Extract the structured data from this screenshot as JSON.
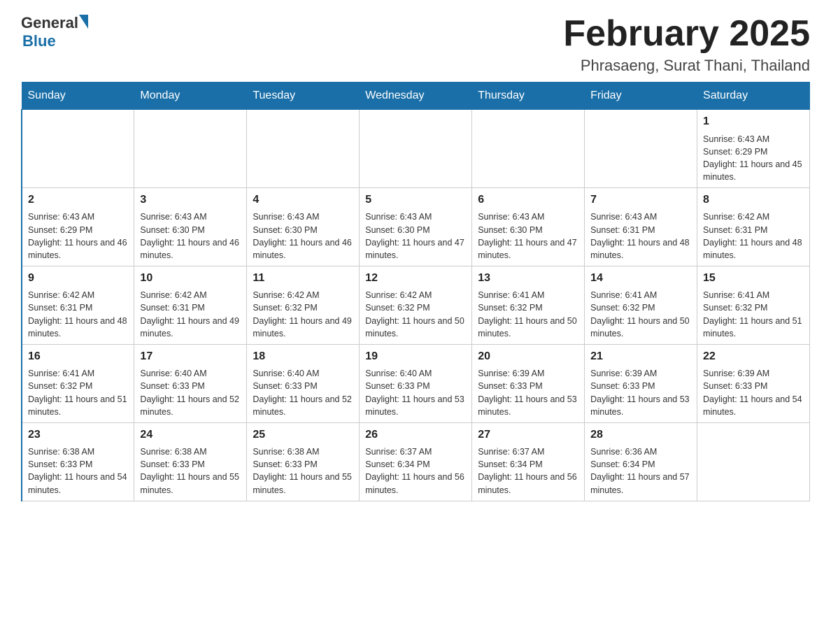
{
  "header": {
    "logo_general": "General",
    "logo_blue": "Blue",
    "month_title": "February 2025",
    "location": "Phrasaeng, Surat Thani, Thailand"
  },
  "weekdays": [
    "Sunday",
    "Monday",
    "Tuesday",
    "Wednesday",
    "Thursday",
    "Friday",
    "Saturday"
  ],
  "weeks": [
    [
      {
        "day": "",
        "sunrise": "",
        "sunset": "",
        "daylight": ""
      },
      {
        "day": "",
        "sunrise": "",
        "sunset": "",
        "daylight": ""
      },
      {
        "day": "",
        "sunrise": "",
        "sunset": "",
        "daylight": ""
      },
      {
        "day": "",
        "sunrise": "",
        "sunset": "",
        "daylight": ""
      },
      {
        "day": "",
        "sunrise": "",
        "sunset": "",
        "daylight": ""
      },
      {
        "day": "",
        "sunrise": "",
        "sunset": "",
        "daylight": ""
      },
      {
        "day": "1",
        "sunrise": "Sunrise: 6:43 AM",
        "sunset": "Sunset: 6:29 PM",
        "daylight": "Daylight: 11 hours and 45 minutes."
      }
    ],
    [
      {
        "day": "2",
        "sunrise": "Sunrise: 6:43 AM",
        "sunset": "Sunset: 6:29 PM",
        "daylight": "Daylight: 11 hours and 46 minutes."
      },
      {
        "day": "3",
        "sunrise": "Sunrise: 6:43 AM",
        "sunset": "Sunset: 6:30 PM",
        "daylight": "Daylight: 11 hours and 46 minutes."
      },
      {
        "day": "4",
        "sunrise": "Sunrise: 6:43 AM",
        "sunset": "Sunset: 6:30 PM",
        "daylight": "Daylight: 11 hours and 46 minutes."
      },
      {
        "day": "5",
        "sunrise": "Sunrise: 6:43 AM",
        "sunset": "Sunset: 6:30 PM",
        "daylight": "Daylight: 11 hours and 47 minutes."
      },
      {
        "day": "6",
        "sunrise": "Sunrise: 6:43 AM",
        "sunset": "Sunset: 6:30 PM",
        "daylight": "Daylight: 11 hours and 47 minutes."
      },
      {
        "day": "7",
        "sunrise": "Sunrise: 6:43 AM",
        "sunset": "Sunset: 6:31 PM",
        "daylight": "Daylight: 11 hours and 48 minutes."
      },
      {
        "day": "8",
        "sunrise": "Sunrise: 6:42 AM",
        "sunset": "Sunset: 6:31 PM",
        "daylight": "Daylight: 11 hours and 48 minutes."
      }
    ],
    [
      {
        "day": "9",
        "sunrise": "Sunrise: 6:42 AM",
        "sunset": "Sunset: 6:31 PM",
        "daylight": "Daylight: 11 hours and 48 minutes."
      },
      {
        "day": "10",
        "sunrise": "Sunrise: 6:42 AM",
        "sunset": "Sunset: 6:31 PM",
        "daylight": "Daylight: 11 hours and 49 minutes."
      },
      {
        "day": "11",
        "sunrise": "Sunrise: 6:42 AM",
        "sunset": "Sunset: 6:32 PM",
        "daylight": "Daylight: 11 hours and 49 minutes."
      },
      {
        "day": "12",
        "sunrise": "Sunrise: 6:42 AM",
        "sunset": "Sunset: 6:32 PM",
        "daylight": "Daylight: 11 hours and 50 minutes."
      },
      {
        "day": "13",
        "sunrise": "Sunrise: 6:41 AM",
        "sunset": "Sunset: 6:32 PM",
        "daylight": "Daylight: 11 hours and 50 minutes."
      },
      {
        "day": "14",
        "sunrise": "Sunrise: 6:41 AM",
        "sunset": "Sunset: 6:32 PM",
        "daylight": "Daylight: 11 hours and 50 minutes."
      },
      {
        "day": "15",
        "sunrise": "Sunrise: 6:41 AM",
        "sunset": "Sunset: 6:32 PM",
        "daylight": "Daylight: 11 hours and 51 minutes."
      }
    ],
    [
      {
        "day": "16",
        "sunrise": "Sunrise: 6:41 AM",
        "sunset": "Sunset: 6:32 PM",
        "daylight": "Daylight: 11 hours and 51 minutes."
      },
      {
        "day": "17",
        "sunrise": "Sunrise: 6:40 AM",
        "sunset": "Sunset: 6:33 PM",
        "daylight": "Daylight: 11 hours and 52 minutes."
      },
      {
        "day": "18",
        "sunrise": "Sunrise: 6:40 AM",
        "sunset": "Sunset: 6:33 PM",
        "daylight": "Daylight: 11 hours and 52 minutes."
      },
      {
        "day": "19",
        "sunrise": "Sunrise: 6:40 AM",
        "sunset": "Sunset: 6:33 PM",
        "daylight": "Daylight: 11 hours and 53 minutes."
      },
      {
        "day": "20",
        "sunrise": "Sunrise: 6:39 AM",
        "sunset": "Sunset: 6:33 PM",
        "daylight": "Daylight: 11 hours and 53 minutes."
      },
      {
        "day": "21",
        "sunrise": "Sunrise: 6:39 AM",
        "sunset": "Sunset: 6:33 PM",
        "daylight": "Daylight: 11 hours and 53 minutes."
      },
      {
        "day": "22",
        "sunrise": "Sunrise: 6:39 AM",
        "sunset": "Sunset: 6:33 PM",
        "daylight": "Daylight: 11 hours and 54 minutes."
      }
    ],
    [
      {
        "day": "23",
        "sunrise": "Sunrise: 6:38 AM",
        "sunset": "Sunset: 6:33 PM",
        "daylight": "Daylight: 11 hours and 54 minutes."
      },
      {
        "day": "24",
        "sunrise": "Sunrise: 6:38 AM",
        "sunset": "Sunset: 6:33 PM",
        "daylight": "Daylight: 11 hours and 55 minutes."
      },
      {
        "day": "25",
        "sunrise": "Sunrise: 6:38 AM",
        "sunset": "Sunset: 6:33 PM",
        "daylight": "Daylight: 11 hours and 55 minutes."
      },
      {
        "day": "26",
        "sunrise": "Sunrise: 6:37 AM",
        "sunset": "Sunset: 6:34 PM",
        "daylight": "Daylight: 11 hours and 56 minutes."
      },
      {
        "day": "27",
        "sunrise": "Sunrise: 6:37 AM",
        "sunset": "Sunset: 6:34 PM",
        "daylight": "Daylight: 11 hours and 56 minutes."
      },
      {
        "day": "28",
        "sunrise": "Sunrise: 6:36 AM",
        "sunset": "Sunset: 6:34 PM",
        "daylight": "Daylight: 11 hours and 57 minutes."
      },
      {
        "day": "",
        "sunrise": "",
        "sunset": "",
        "daylight": ""
      }
    ]
  ]
}
